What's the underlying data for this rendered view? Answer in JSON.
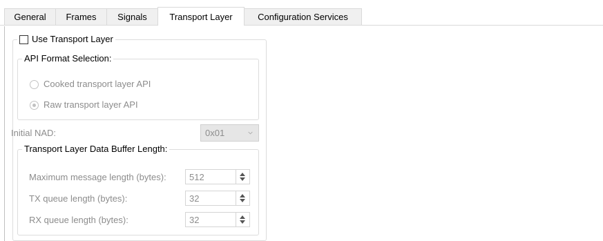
{
  "tabs": [
    {
      "label": "General",
      "active": false
    },
    {
      "label": "Frames",
      "active": false
    },
    {
      "label": "Signals",
      "active": false
    },
    {
      "label": "Transport Layer",
      "active": true
    },
    {
      "label": "Configuration Services",
      "active": false
    }
  ],
  "use_transport_layer": {
    "label": "Use Transport Layer",
    "checked": false
  },
  "api_format": {
    "title": "API Format Selection:",
    "options": [
      {
        "label": "Cooked transport layer API",
        "selected": false
      },
      {
        "label": "Raw transport layer API",
        "selected": true
      }
    ]
  },
  "initial_nad": {
    "label": "Initial NAD:",
    "value": "0x01"
  },
  "buffer": {
    "title": "Transport Layer Data Buffer Length:",
    "fields": [
      {
        "label": "Maximum message length (bytes):",
        "value": "512"
      },
      {
        "label": "TX queue length (bytes):",
        "value": "32"
      },
      {
        "label": "RX queue length (bytes):",
        "value": "32"
      }
    ]
  },
  "colors": {
    "disabled_text": "#8c8c8c",
    "tab_bg": "#f0f0f0",
    "active_tab_bg": "#ffffff"
  }
}
